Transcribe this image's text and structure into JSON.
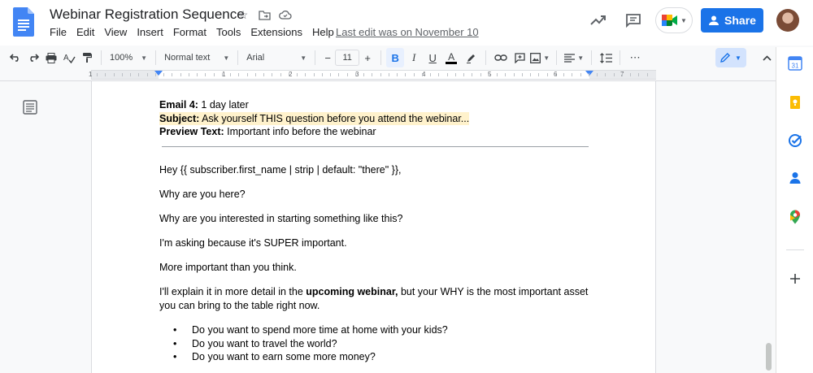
{
  "doc": {
    "title": "Webinar Registration Sequence",
    "last_edit": "Last edit was on November 10"
  },
  "menu": [
    "File",
    "Edit",
    "View",
    "Insert",
    "Format",
    "Tools",
    "Extensions",
    "Help"
  ],
  "header": {
    "share_label": "Share"
  },
  "toolbar": {
    "zoom": "100%",
    "style": "Normal text",
    "font": "Arial",
    "font_size": "11",
    "minus": "−",
    "plus": "+",
    "bold": "B",
    "italic": "I",
    "underline": "U",
    "text_color": "A",
    "more": "⋯"
  },
  "ruler": {
    "numbers": [
      "1",
      "1",
      "2",
      "3",
      "4",
      "5",
      "6",
      "7"
    ]
  },
  "email": {
    "label": "Email 4:",
    "timing": " 1 day later",
    "subject_label": "Subject:",
    "subject": " Ask yourself THIS question before you attend the webinar...",
    "preview_label": "Preview Text:",
    "preview": " Important info before the webinar"
  },
  "body": {
    "greeting": "Hey {{ subscriber.first_name | strip | default: \"there\" }},",
    "p1": "Why are you here?",
    "p2": "Why are you interested in starting something like this?",
    "p3": "I'm asking because it's SUPER important.",
    "p4": "More important than you think.",
    "p5_pre": "I'll explain it in more detail in the ",
    "p5_bold": "upcoming webinar,",
    "p5_post": " but your WHY is the most important asset you can bring to the table right now.",
    "bullets": [
      "Do you want to spend more time at home with your kids?",
      "Do you want to travel the world?",
      "Do you want to earn some more money?"
    ]
  },
  "colors": {
    "accent": "#1a73e8",
    "highlight": "#fff2cc"
  }
}
